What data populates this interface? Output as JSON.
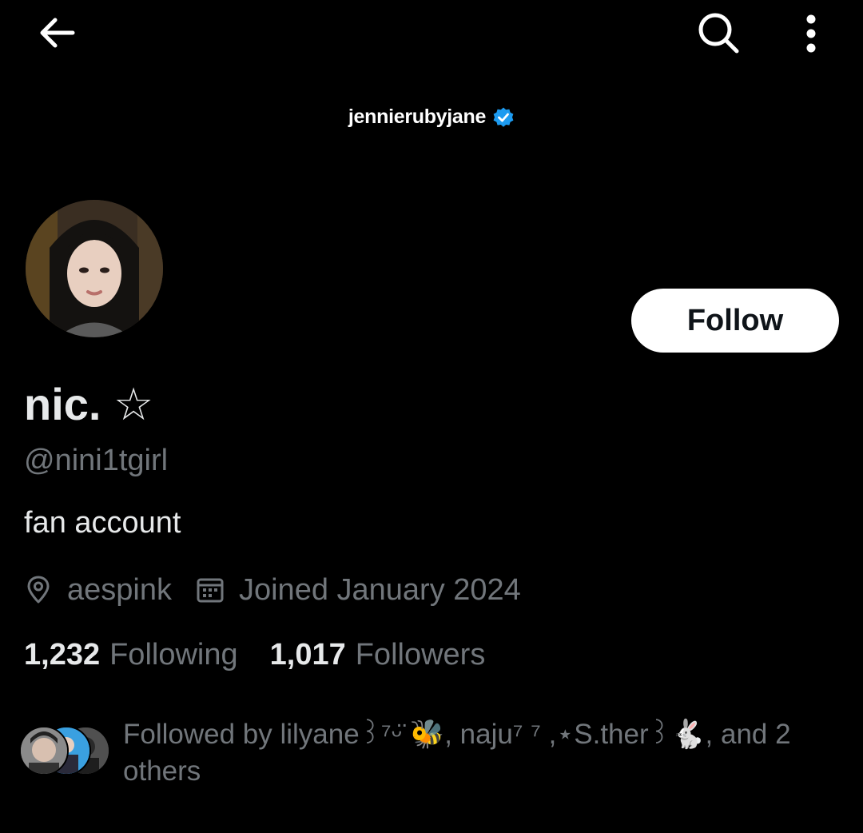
{
  "header": {
    "back_icon": "arrow-left-icon",
    "search_icon": "search-icon",
    "more_icon": "more-vertical-icon"
  },
  "banner": {
    "text": "jennierubyjane",
    "verified_icon": "verified-badge-icon",
    "verified_color": "#1d9bf0"
  },
  "profile": {
    "display_name": "nic. ☆",
    "handle": "@nini1tgirl",
    "bio": "fan account",
    "location": "aespink",
    "joined": "Joined January 2024",
    "follow_label": "Follow"
  },
  "stats": {
    "following_count": "1,232",
    "following_label": "Following",
    "followers_count": "1,017",
    "followers_label": "Followers"
  },
  "followed_by": {
    "text": "Followed by lilyane꒱⁷ᵕ̈ 🐝, naju⁷ ⁷ ,⋆S.ther꒱🐇, and 2 others"
  },
  "colors": {
    "background": "#000000",
    "primary_text": "#e7e9ea",
    "secondary_text": "#71767b",
    "button_bg": "#ffffff"
  }
}
